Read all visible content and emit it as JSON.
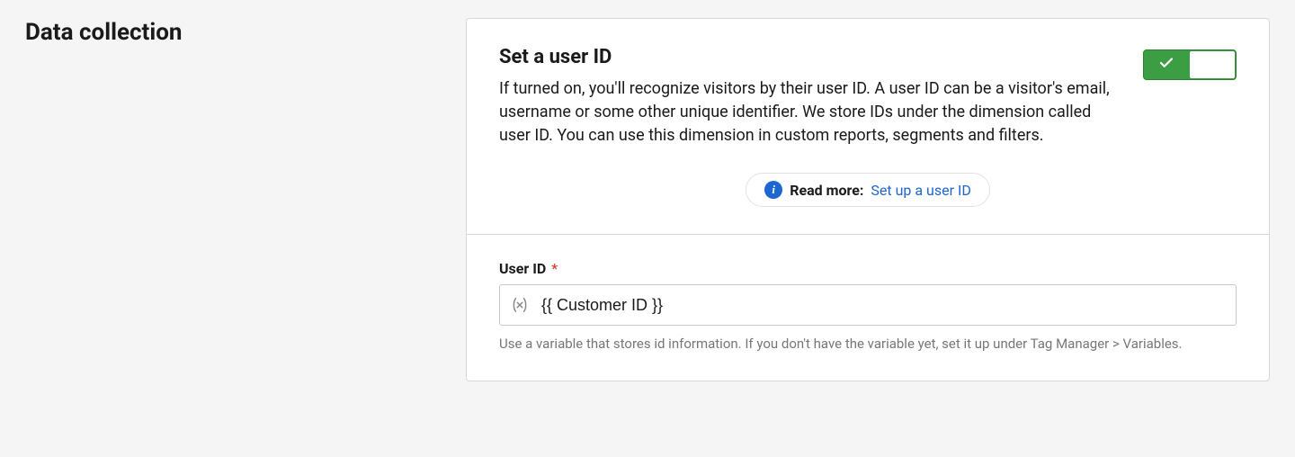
{
  "section": {
    "title": "Data collection"
  },
  "card": {
    "title": "Set a user ID",
    "description": "If turned on, you'll recognize visitors by their user ID. A user ID can be a visitor's email, username or some other unique identifier. We store IDs under the dimension called user ID. You can use this dimension in custom reports, segments and filters.",
    "toggle_on": true,
    "readmore_label": "Read more:",
    "readmore_link_text": "Set up a user ID"
  },
  "field": {
    "label": "User ID",
    "required_marker": "*",
    "value": "{{ Customer ID }}",
    "help": "Use a variable that stores id information. If you don't have the variable yet, set it up under Tag Manager > Variables."
  }
}
